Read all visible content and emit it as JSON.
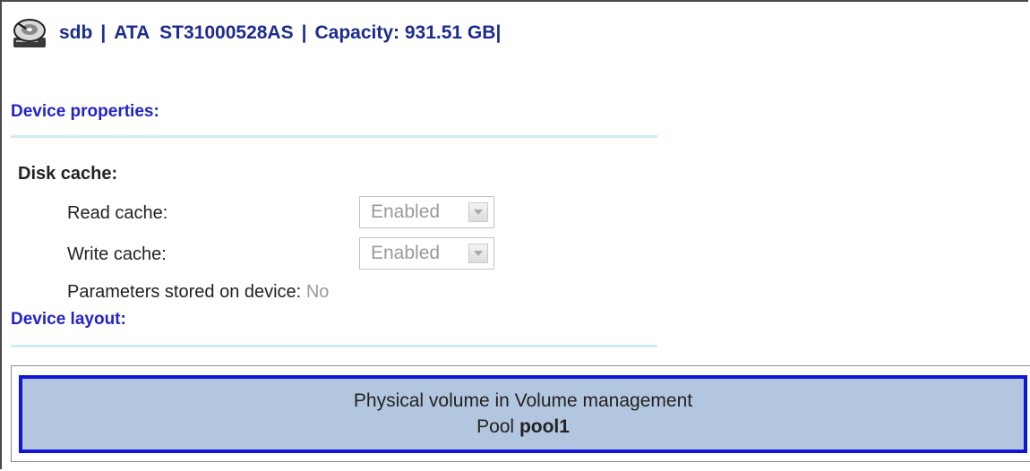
{
  "header": {
    "icon": "hard-disk-icon",
    "device": "sdb",
    "separator": "|",
    "model": "ATA  ST31000528AS",
    "capacity_label": "Capacity: 931.51 GB",
    "trailing_separator": "|"
  },
  "device_properties": {
    "title": "Device properties:"
  },
  "disk_cache": {
    "title": "Disk cache:",
    "read_cache": {
      "label": "Read cache:",
      "value": "Enabled"
    },
    "write_cache": {
      "label": "Write cache:",
      "value": "Enabled"
    },
    "stored": {
      "label": "Parameters stored on device:",
      "value": "No"
    }
  },
  "device_layout": {
    "title": "Device layout:",
    "volume": {
      "line1": "Physical volume in Volume management",
      "pool_prefix": "Pool",
      "pool_name": "pool1"
    }
  },
  "colors": {
    "header_text": "#1c2b8f",
    "section_title": "#2323c8",
    "divider": "#cdeef1",
    "volume_fill": "#b3c6df",
    "volume_border": "#0f16d8"
  }
}
